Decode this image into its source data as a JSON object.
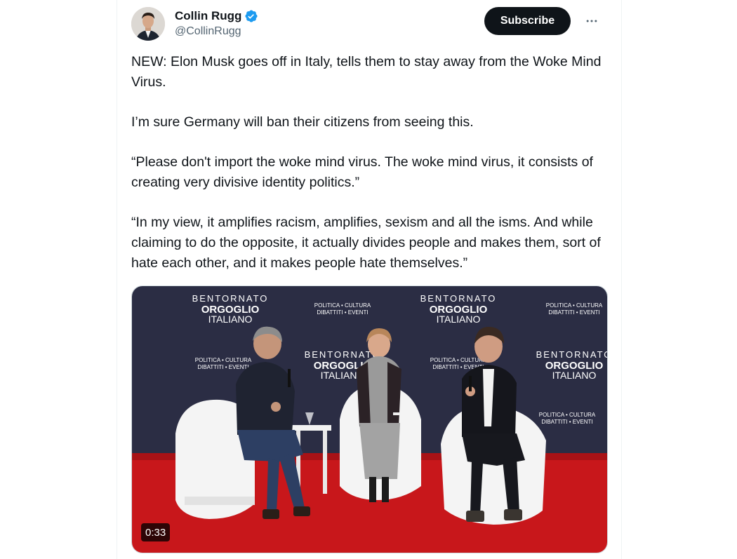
{
  "author": {
    "display_name": "Collin Rugg",
    "handle": "@CollinRugg",
    "verified": true
  },
  "actions": {
    "subscribe_label": "Subscribe",
    "more_icon": "more-horizontal-icon"
  },
  "tweet": {
    "paragraphs": [
      "NEW: Elon Musk goes off in Italy, tells them to stay away from the Woke Mind Virus.",
      "I’m sure Germany will ban their citizens from seeing this.",
      "“Please don't import the woke mind virus. The woke mind virus, it consists of creating very divisive identity politics.”",
      "“In my view, it amplifies racism, amplifies, sexism and all the isms. And while claiming to do the opposite, it actually divides people and makes them, sort of hate each other, and it makes people hate themselves.”"
    ]
  },
  "media": {
    "duration": "0:33",
    "backdrop_text": {
      "brand_line1": "BENTORNATO",
      "brand_line2": "ORGOGLIO",
      "brand_line3": "ITALIANO",
      "tagline1": "POLITICA • CULTURA",
      "tagline2": "DIBATTITI • EVENTI"
    }
  },
  "colors": {
    "verified": "#1d9bf0",
    "subscribe_bg": "#0f1419",
    "backdrop": "#2b2d44",
    "carpet": "#c8171b",
    "chair": "#f4f4f4",
    "handle": "#536471"
  }
}
